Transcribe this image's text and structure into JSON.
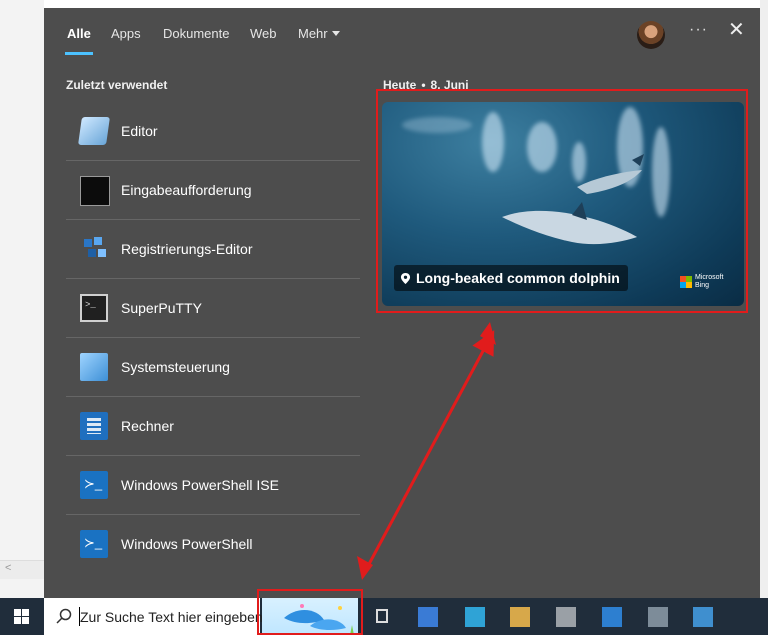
{
  "tabs": [
    {
      "label": "Alle",
      "active": true
    },
    {
      "label": "Apps"
    },
    {
      "label": "Dokumente"
    },
    {
      "label": "Web"
    },
    {
      "label": "Mehr"
    }
  ],
  "header": {
    "more_menu": "···",
    "close": "✕"
  },
  "recent": {
    "title": "Zuletzt verwendet",
    "items": [
      {
        "label": "Editor",
        "icon": "notepad-icon"
      },
      {
        "label": "Eingabeaufforderung",
        "icon": "command-prompt-icon"
      },
      {
        "label": "Registrierungs-Editor",
        "icon": "registry-editor-icon"
      },
      {
        "label": "SuperPuTTY",
        "icon": "terminal-icon"
      },
      {
        "label": "Systemsteuerung",
        "icon": "control-panel-icon"
      },
      {
        "label": "Rechner",
        "icon": "calculator-icon"
      },
      {
        "label": "Windows PowerShell ISE",
        "icon": "powershell-ise-icon"
      },
      {
        "label": "Windows PowerShell",
        "icon": "powershell-icon"
      }
    ]
  },
  "today": {
    "label": "Heute",
    "separator": "•",
    "date": "8. Juni",
    "card_caption": "Long-beaked common dolphin",
    "brand_line1": "Microsoft",
    "brand_line2": "Bing"
  },
  "taskbar": {
    "search_placeholder": "Zur Suche Text hier eingeben"
  },
  "colors": {
    "panel": "#4d4d4d",
    "accent": "#4cc2ff",
    "highlight": "#e11c1c",
    "taskbar": "#202d3b"
  }
}
